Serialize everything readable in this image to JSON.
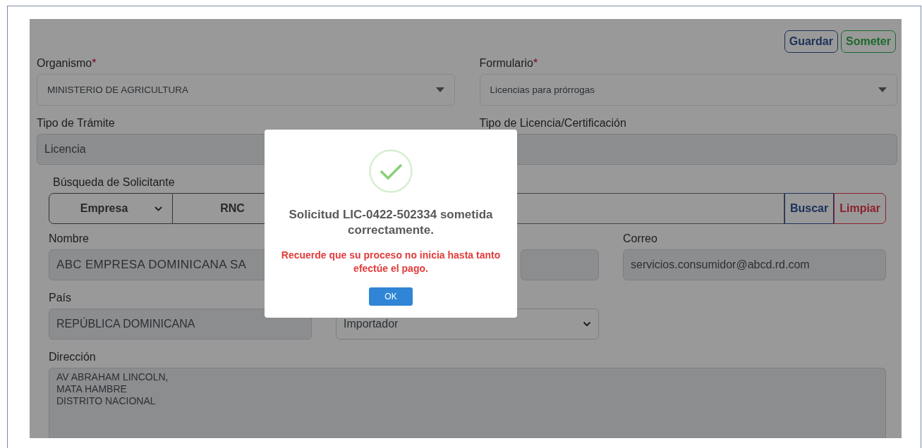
{
  "actions": [
    {
      "label": "Guardar",
      "kind": "primary"
    },
    {
      "label": "Someter",
      "kind": "success"
    }
  ],
  "top_fields": [
    {
      "label": "Organismo",
      "required_mark": "*",
      "value": "MINISTERIO DE AGRICULTURA",
      "kind": "dropdown"
    },
    {
      "label": "Formulario",
      "required_mark": "*",
      "value": "Licencias para prórrogas",
      "kind": "dropdown"
    },
    {
      "label": "Tipo de Trámite",
      "value": "Licencia",
      "kind": "readonly"
    },
    {
      "label": "Tipo de Licencia/Certificación",
      "kind": "readonly"
    }
  ],
  "applicant_search": {
    "label": "Búsqueda de Solicitante",
    "applicant_type": "Empresa",
    "id_type": "RNC",
    "buttons": [
      {
        "label": "Buscar",
        "kind": "primary"
      },
      {
        "label": "Limpiar",
        "kind": "danger"
      }
    ]
  },
  "applicant_fields": [
    {
      "label": "Nombre",
      "value": "ABC EMPRESA DOMINICANA SA",
      "kind": "readonly"
    },
    {
      "kind": "readonly"
    },
    {
      "label": "Correo",
      "value": "servicios.consumidor@abcd.rd.com",
      "kind": "readonly"
    },
    {
      "label": "País",
      "value": "REPÚBLICA DOMINICANA",
      "kind": "readonly"
    },
    {
      "value": "Importador",
      "kind": "select"
    },
    {
      "label": "Dirección",
      "value": "AV ABRAHAM LINCOLN,\nMATA HAMBRE\nDISTRITO NACIONAL",
      "kind": "textarea"
    }
  ],
  "modal": {
    "kind": "success",
    "title": "Solicitud LIC-0422-502334 sometida correctamente.",
    "message": "Recuerde que su proceso no inicia hasta tanto efectúe el pago.",
    "button": "OK"
  }
}
